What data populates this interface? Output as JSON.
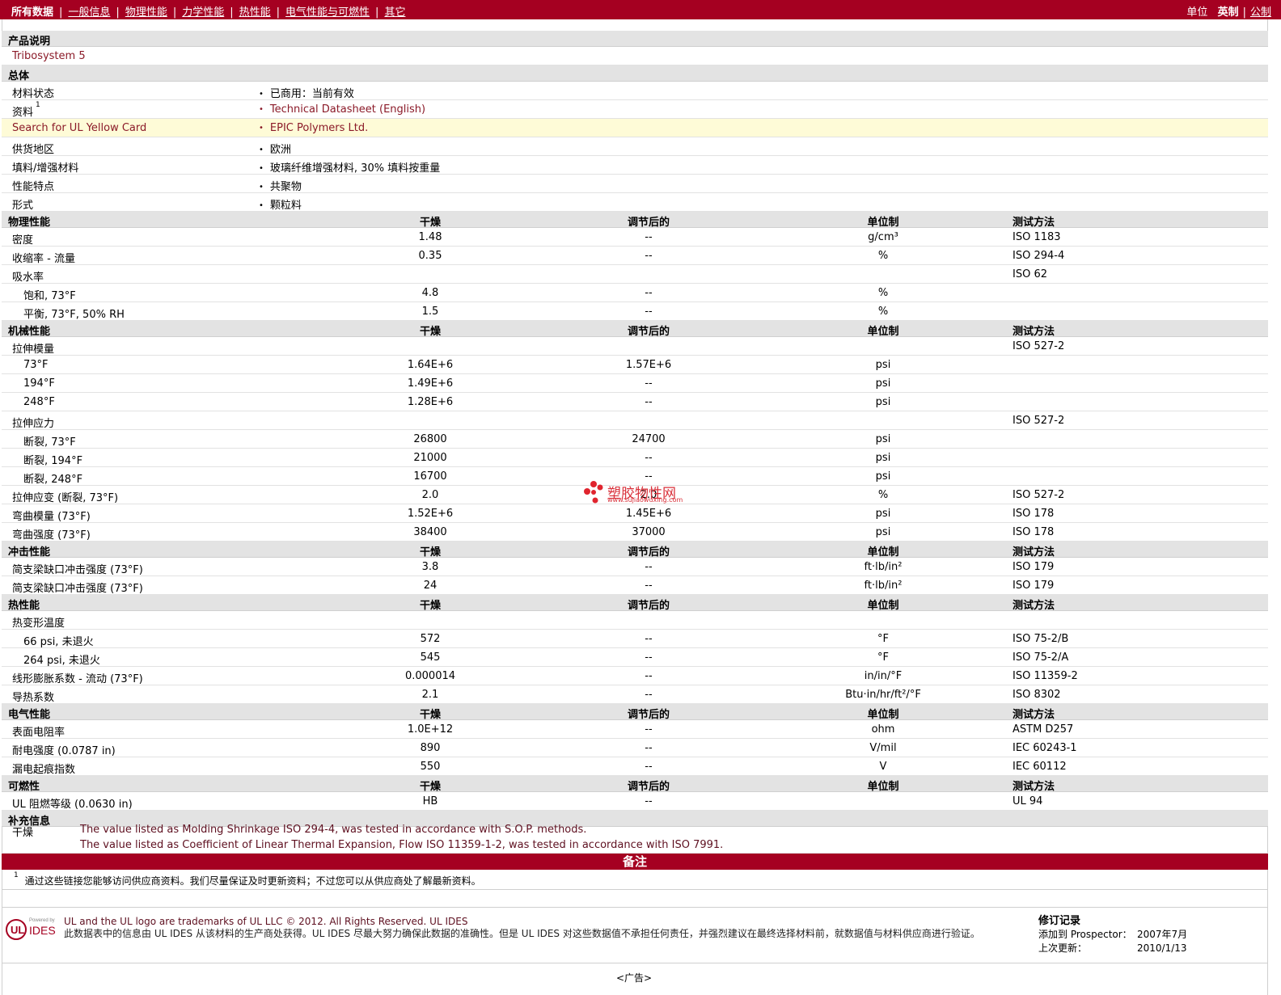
{
  "nav": {
    "items": [
      "所有数据",
      "一般信息",
      "物理性能",
      "力学性能",
      "热性能",
      "电气性能与可燃性",
      "其它"
    ]
  },
  "units": {
    "label": "单位",
    "imperial": "英制",
    "metric": "公制"
  },
  "product_desc": {
    "title": "产品说明",
    "name": "Tribosystem 5"
  },
  "general": {
    "title": "总体",
    "rows": [
      {
        "label": "材料状态",
        "value": "已商用：当前有效"
      },
      {
        "label": "资料",
        "sup": "1",
        "value": "Technical Datasheet (English)"
      },
      {
        "label": "Search for UL Yellow Card",
        "value": "EPIC Polymers Ltd."
      },
      {
        "label": "供货地区",
        "value": "欧洲"
      },
      {
        "label": "填料/增强材料",
        "value": "玻璃纤维增强材料, 30% 填料按重量"
      },
      {
        "label": "性能特点",
        "value": "共聚物"
      },
      {
        "label": "形式",
        "value": "颗粒料"
      }
    ]
  },
  "col_headers": {
    "dry": "干燥",
    "cond": "调节后的",
    "unit": "单位制",
    "method": "测试方法"
  },
  "physical": {
    "title": "物理性能",
    "rows": [
      {
        "label": "密度",
        "dry": "1.48",
        "cond": "--",
        "unit": "g/cm³",
        "method": "ISO 1183"
      },
      {
        "label": "收缩率  - 流量",
        "dry": "0.35",
        "cond": "--",
        "unit": "%",
        "method": "ISO 294-4"
      },
      {
        "label": "吸水率",
        "method": "ISO 62"
      },
      {
        "label": "饱和, 73°F",
        "indent": true,
        "dry": "4.8",
        "cond": "--",
        "unit": "%"
      },
      {
        "label": "平衡, 73°F, 50% RH",
        "indent": true,
        "dry": "1.5",
        "cond": "--",
        "unit": "%"
      }
    ]
  },
  "mechanical": {
    "title": "机械性能",
    "rows": [
      {
        "label": "拉伸模量",
        "method": "ISO 527-2"
      },
      {
        "label": "73°F",
        "indent": true,
        "dry": "1.64E+6",
        "cond": "1.57E+6",
        "unit": "psi"
      },
      {
        "label": "194°F",
        "indent": true,
        "dry": "1.49E+6",
        "cond": "--",
        "unit": "psi"
      },
      {
        "label": "248°F",
        "indent": true,
        "dry": "1.28E+6",
        "cond": "--",
        "unit": "psi"
      },
      {
        "label": "拉伸应力",
        "method": "ISO 527-2"
      },
      {
        "label": "断裂, 73°F",
        "indent": true,
        "dry": "26800",
        "cond": "24700",
        "unit": "psi"
      },
      {
        "label": "断裂, 194°F",
        "indent": true,
        "dry": "21000",
        "cond": "--",
        "unit": "psi"
      },
      {
        "label": "断裂, 248°F",
        "indent": true,
        "dry": "16700",
        "cond": "--",
        "unit": "psi"
      },
      {
        "label": "拉伸应变  (断裂, 73°F)",
        "dry": "2.0",
        "cond": "2.0",
        "unit": "%",
        "method": "ISO 527-2"
      },
      {
        "label": "弯曲模量  (73°F)",
        "dry": "1.52E+6",
        "cond": "1.45E+6",
        "unit": "psi",
        "method": "ISO 178"
      },
      {
        "label": "弯曲强度  (73°F)",
        "dry": "38400",
        "cond": "37000",
        "unit": "psi",
        "method": "ISO 178"
      }
    ]
  },
  "impact": {
    "title": "冲击性能",
    "rows": [
      {
        "label": "简支梁缺口冲击强度  (73°F)",
        "dry": "3.8",
        "cond": "--",
        "unit": "ft·lb/in²",
        "method": "ISO 179"
      },
      {
        "label": "简支梁缺口冲击强度  (73°F)",
        "dry": "24",
        "cond": "--",
        "unit": "ft·lb/in²",
        "method": "ISO 179"
      }
    ]
  },
  "thermal": {
    "title": "热性能",
    "rows": [
      {
        "label": "热变形温度"
      },
      {
        "label": "66 psi, 未退火",
        "indent": true,
        "dry": "572",
        "cond": "--",
        "unit": "°F",
        "method": "ISO 75-2/B"
      },
      {
        "label": "264 psi, 未退火",
        "indent": true,
        "dry": "545",
        "cond": "--",
        "unit": "°F",
        "method": "ISO 75-2/A"
      },
      {
        "label": "线形膨胀系数  - 流动  (73°F)",
        "dry": "0.000014",
        "cond": "--",
        "unit": "in/in/°F",
        "method": "ISO 11359-2"
      },
      {
        "label": "导热系数",
        "dry": "2.1",
        "cond": "--",
        "unit": "Btu·in/hr/ft²/°F",
        "method": "ISO 8302"
      }
    ]
  },
  "electrical": {
    "title": "电气性能",
    "rows": [
      {
        "label": "表面电阻率",
        "dry": "1.0E+12",
        "cond": "--",
        "unit": "ohm",
        "method": "ASTM D257"
      },
      {
        "label": "耐电强度  (0.0787 in)",
        "dry": "890",
        "cond": "--",
        "unit": "V/mil",
        "method": "IEC 60243-1"
      },
      {
        "label": "漏电起痕指数",
        "dry": "550",
        "cond": "--",
        "unit": "V",
        "method": "IEC 60112"
      }
    ]
  },
  "flammability": {
    "title": "可燃性",
    "rows": [
      {
        "label": "UL 阻燃等级  (0.0630 in)",
        "dry": "HB",
        "cond": "--",
        "method": "UL 94"
      }
    ]
  },
  "supplemental": {
    "title": "补充信息",
    "label": "干燥",
    "lines": [
      "The value listed as Molding Shrinkage ISO 294-4, was tested in accordance with S.O.P. methods.",
      "The value listed as Coefficient of Linear Thermal Expansion, Flow ISO 11359-1-2, was tested in accordance with ISO 7991."
    ]
  },
  "remarks": {
    "title": "备注",
    "sup": "1",
    "text": "通过这些链接您能够访问供应商资料。我们尽量保证及时更新资料；不过您可以从供应商处了解最新资料。"
  },
  "footer": {
    "logo_powered": "Powered by",
    "logo_ul": "UL",
    "logo_ides": "IDES",
    "line1": "UL and the UL logo are trademarks of UL LLC © 2012. All Rights Reserved. UL IDES",
    "line2": "此数据表中的信息由  UL IDES 从该材料的生产商处获得。UL IDES 尽最大努力确保此数据的准确性。但是  UL IDES 对这些数据值不承担任何责任，并强烈建议在最终选择材料前，就数据值与材料供应商进行验证。"
  },
  "revision": {
    "title": "修订记录",
    "added_label": "添加到  Prospector：",
    "added_value": "2007年7月",
    "updated_label": "上次更新：",
    "updated_value": "2010/1/13"
  },
  "ad": "<广告>",
  "watermark": {
    "text": "塑胶物性网",
    "url": "www.sujiaowuxing.com"
  },
  "colors": {
    "brand": "#a50021",
    "link": "#8b1a28",
    "highlight": "#fefbd7",
    "section_bg": "#e3e3e3"
  }
}
